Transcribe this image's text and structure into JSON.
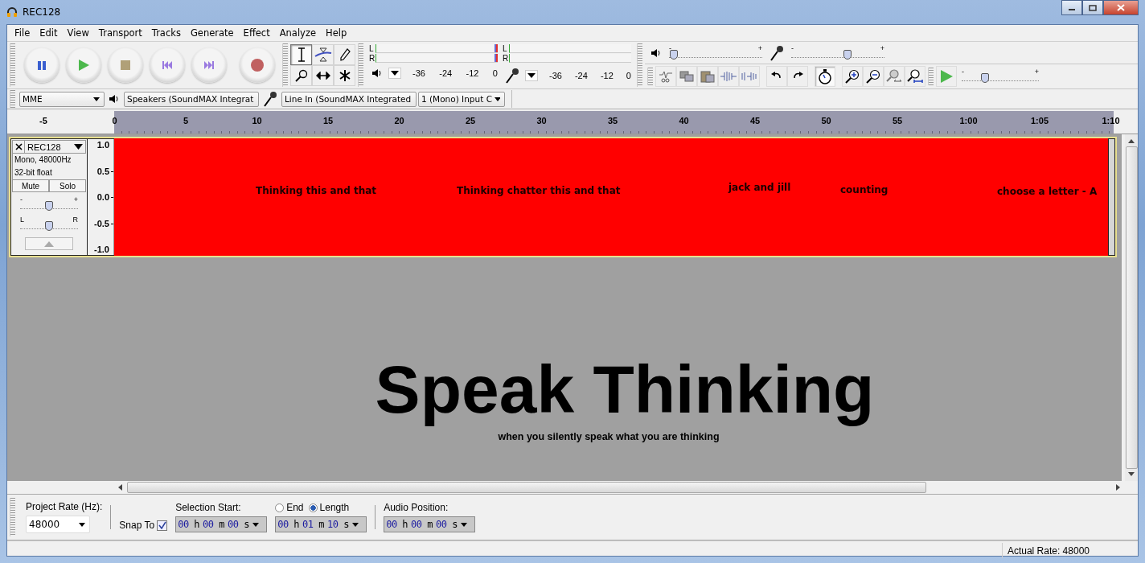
{
  "window": {
    "title": "REC128"
  },
  "menu": [
    "File",
    "Edit",
    "View",
    "Transport",
    "Tracks",
    "Generate",
    "Effect",
    "Analyze",
    "Help"
  ],
  "tools": [
    {
      "kind": "ibeam",
      "selected": true
    },
    {
      "kind": "envelope",
      "selected": false
    },
    {
      "kind": "pencil",
      "selected": false
    },
    {
      "kind": "zoom",
      "selected": false
    },
    {
      "kind": "timeshift",
      "selected": false
    },
    {
      "kind": "multi",
      "selected": false
    }
  ],
  "meters": [
    {
      "kind": "playback",
      "channels": [
        "L",
        "R"
      ],
      "ticks": [
        "-36",
        "-24",
        "-12",
        "0"
      ]
    },
    {
      "kind": "recording",
      "channels": [
        "L",
        "R"
      ],
      "ticks": [
        "-36",
        "-24",
        "-12",
        "0"
      ]
    }
  ],
  "mixer": [
    {
      "kind": "speaker",
      "min_label": "-",
      "max_label": "+",
      "level": 0.05
    },
    {
      "kind": "mic",
      "min_label": "-",
      "max_label": "+",
      "level": 0.6
    }
  ],
  "play_at_speed": {
    "min_label": "-",
    "max_label": "+",
    "level": 0.3
  },
  "devices": {
    "host": "MME",
    "output": "Speakers (SoundMAX Integrat",
    "input": "Line In (SoundMAX Integrated",
    "channels": "1 (Mono) Input C"
  },
  "ruler": {
    "ticks": [
      "-5",
      "0",
      "5",
      "10",
      "15",
      "20",
      "25",
      "30",
      "35",
      "40",
      "45",
      "50",
      "55",
      "1:00",
      "1:05",
      "1:10"
    ]
  },
  "track": {
    "name": "REC128",
    "info": [
      "Mono, 48000Hz",
      "32-bit float"
    ],
    "mute": "Mute",
    "solo": "Solo",
    "gain": {
      "min_label": "-",
      "max_label": "+",
      "level": 0.5
    },
    "pan": {
      "min_label": "L",
      "max_label": "R",
      "level": 0.5
    },
    "scale": [
      "1.0",
      "0.5",
      "0.0",
      "-0.5",
      "-1.0"
    ],
    "labels": [
      "Thinking this and that",
      "Thinking chatter this and that",
      "jack and jill",
      "counting",
      "choose a letter - A"
    ]
  },
  "overlay": {
    "title": "Speak Thinking",
    "subtitle": "when you silently speak what you are thinking"
  },
  "selection_bar": {
    "project_rate_label": "Project Rate (Hz):",
    "project_rate": "48000",
    "snap": {
      "label": "Snap To",
      "checked": true
    },
    "selection_start_label": "Selection Start:",
    "radios": [
      {
        "label": "End",
        "selected": false
      },
      {
        "label": "Length",
        "selected": true
      }
    ],
    "audio_position_label": "Audio Position:",
    "times": [
      [
        {
          "value": "00",
          "unit": "h"
        },
        {
          "value": "00",
          "unit": "m"
        },
        {
          "value": "00",
          "unit": "s"
        }
      ],
      [
        {
          "value": "00",
          "unit": "h"
        },
        {
          "value": "01",
          "unit": "m"
        },
        {
          "value": "10",
          "unit": "s"
        }
      ],
      [
        {
          "value": "00",
          "unit": "h"
        },
        {
          "value": "00",
          "unit": "m"
        },
        {
          "value": "00",
          "unit": "s"
        }
      ]
    ]
  },
  "status_bar": {
    "actual_rate": "Actual Rate: 48000"
  }
}
